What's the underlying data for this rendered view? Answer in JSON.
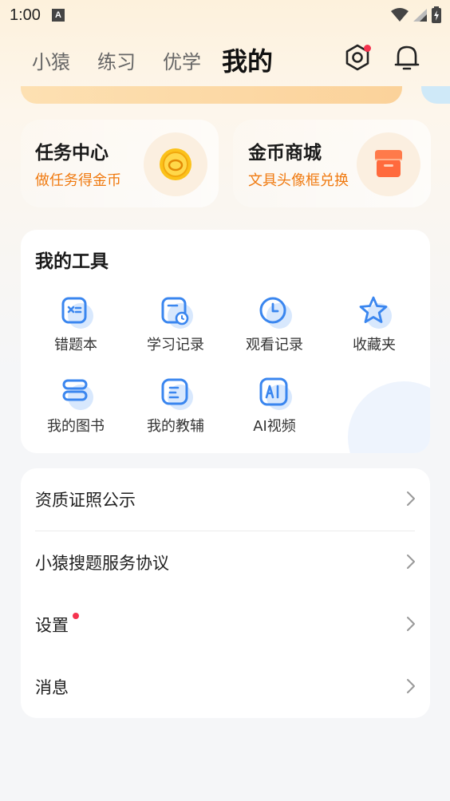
{
  "status_bar": {
    "time": "1:00",
    "notif_letter": "A"
  },
  "nav": {
    "tabs": [
      {
        "label": "小猿"
      },
      {
        "label": "练习"
      },
      {
        "label": "优学"
      },
      {
        "label": "我的"
      }
    ],
    "active_index": 3,
    "scan_icon": "scan-icon",
    "bell_icon": "bell-icon"
  },
  "promo": {
    "task": {
      "title": "任务中心",
      "subtitle": "做任务得金币",
      "icon": "coin-icon"
    },
    "shop": {
      "title": "金币商城",
      "subtitle": "文具头像框兑换",
      "icon": "shop-icon"
    }
  },
  "tools": {
    "title": "我的工具",
    "items": [
      {
        "label": "错题本",
        "icon": "wrong-book-icon"
      },
      {
        "label": "学习记录",
        "icon": "study-record-icon"
      },
      {
        "label": "观看记录",
        "icon": "clock-icon"
      },
      {
        "label": "收藏夹",
        "icon": "star-icon"
      },
      {
        "label": "我的图书",
        "icon": "books-icon"
      },
      {
        "label": "我的教辅",
        "icon": "tutoring-icon"
      },
      {
        "label": "AI视频",
        "icon": "ai-video-icon"
      }
    ]
  },
  "menu": {
    "items": [
      {
        "label": "资质证照公示"
      },
      {
        "label": "小猿搜题服务协议"
      },
      {
        "label": "设置",
        "badge": true
      },
      {
        "label": "消息"
      }
    ]
  },
  "colors": {
    "accent_orange": "#f07a10",
    "icon_blue": "#3a86ef",
    "badge_red": "#f5334e"
  }
}
